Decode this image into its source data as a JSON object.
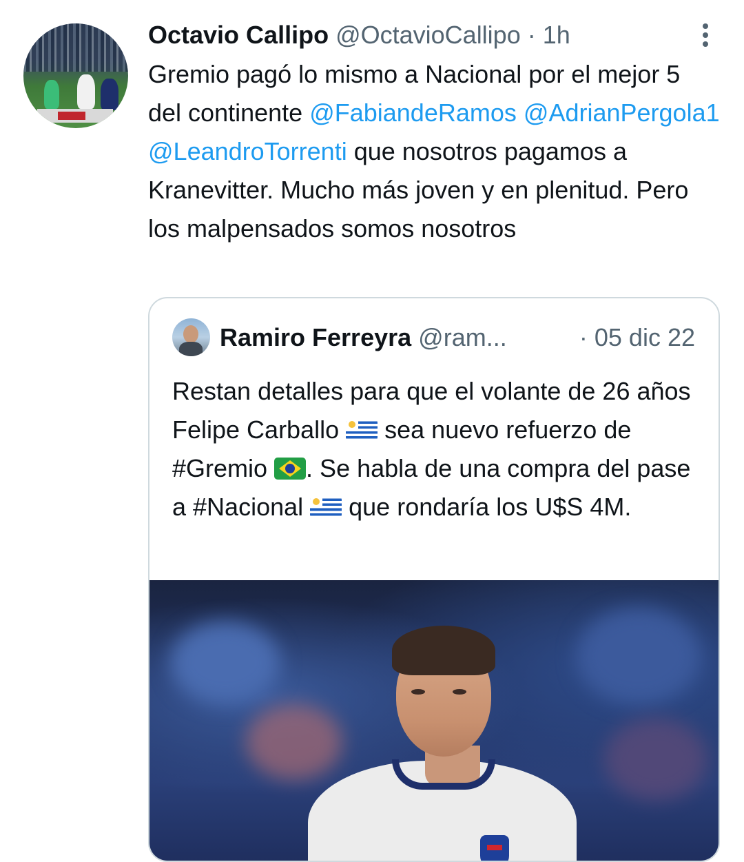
{
  "tweet": {
    "author_name": "Octavio Callipo",
    "author_handle": "@OctavioCallipo",
    "separator": "·",
    "time": "1h",
    "text_part1": "Gremio pagó lo mismo a Nacional por el mejor 5 del continente ",
    "mention1": "@FabiandeRamos",
    "mention2": "@AdrianPergola1",
    "mention3": "@LeandroTorrenti",
    "text_part2": " que nosotros pagamos a Kranevitter. Mucho más joven y en plenitud. Pero los malpensados somos nosotros"
  },
  "quoted": {
    "author_name": "Ramiro Ferreyra",
    "author_handle": "@ram...",
    "time": "· 05 dic 22",
    "text_part1": "Restan detalles para que el volante de 26 años Felipe Carballo ",
    "text_part2": " sea nuevo refuerzo de #Gremio ",
    "text_part3": ". Se habla de una compra del pase a #Nacional ",
    "text_part4": " que rondaría los U$S 4M."
  }
}
